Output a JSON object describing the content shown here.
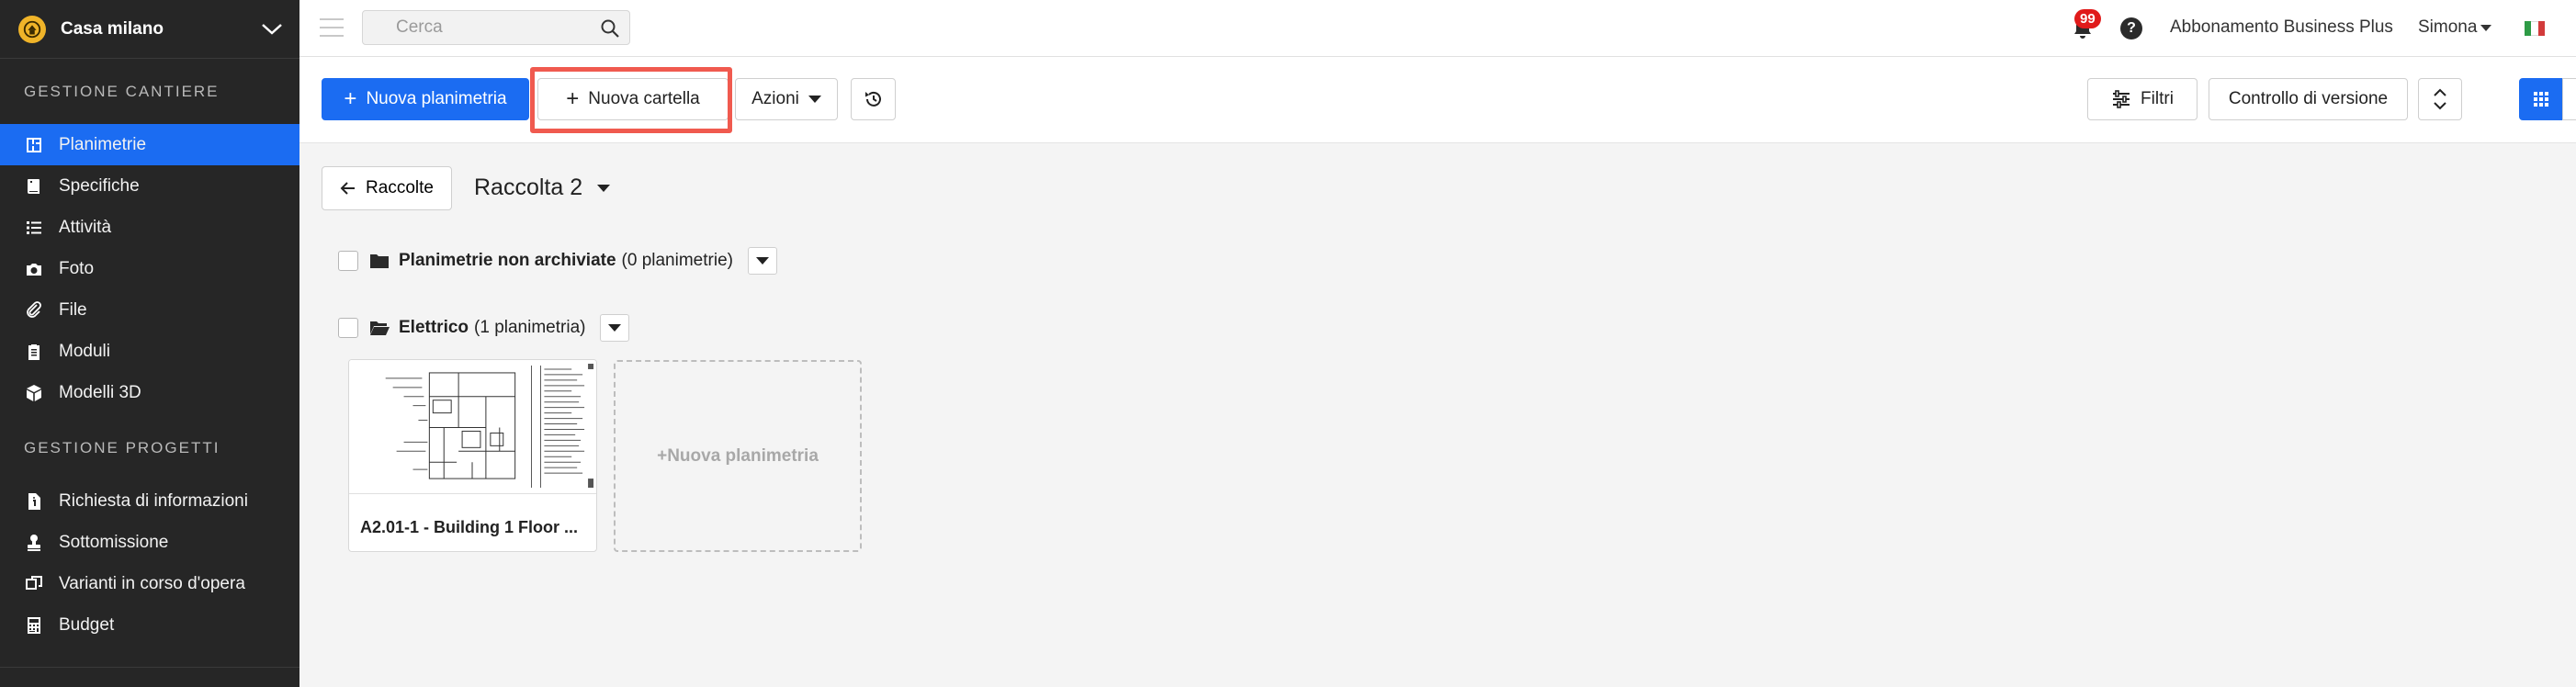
{
  "sidebar": {
    "project_name": "Casa milano",
    "section_site": "GESTIONE CANTIERE",
    "section_projects": "GESTIONE PROGETTI",
    "site_items": [
      {
        "label": "Planimetrie",
        "icon": "floorplan-icon",
        "active": true
      },
      {
        "label": "Specifiche",
        "icon": "book-icon"
      },
      {
        "label": "Attività",
        "icon": "list-icon"
      },
      {
        "label": "Foto",
        "icon": "camera-icon"
      },
      {
        "label": "File",
        "icon": "paperclip-icon"
      },
      {
        "label": "Moduli",
        "icon": "clipboard-icon"
      },
      {
        "label": "Modelli 3D",
        "icon": "cube-icon"
      }
    ],
    "project_items": [
      {
        "label": "Richiesta di informazioni",
        "icon": "document-info-icon"
      },
      {
        "label": "Sottomissione",
        "icon": "stamp-icon"
      },
      {
        "label": "Varianti in corso d'opera",
        "icon": "copy-icon"
      },
      {
        "label": "Budget",
        "icon": "calculator-icon"
      }
    ]
  },
  "topbar": {
    "search_placeholder": "Cerca",
    "notification_count": "99",
    "help_label": "?",
    "subscription": "Abbonamento Business Plus",
    "user_name": "Simona"
  },
  "toolbar": {
    "new_plan": "Nuova planimetria",
    "new_folder": "Nuova cartella",
    "actions": "Azioni",
    "filters": "Filtri",
    "version_control": "Controllo di versione"
  },
  "content": {
    "back_label": "Raccolte",
    "collection_title": "Raccolta 2",
    "folders": [
      {
        "name": "Planimetrie non archiviate",
        "count": "(0 planimetrie)"
      },
      {
        "name": "Elettrico",
        "count": "(1 planimetria)"
      }
    ],
    "plan_card_title": "A2.01-1 - Building 1 Floor ...",
    "new_plan_placeholder": "+Nuova planimetria"
  },
  "colors": {
    "accent": "#1b6cf2",
    "sidebar_bg": "#262626",
    "highlight": "#f05a4f",
    "badge": "#e01b1b"
  }
}
